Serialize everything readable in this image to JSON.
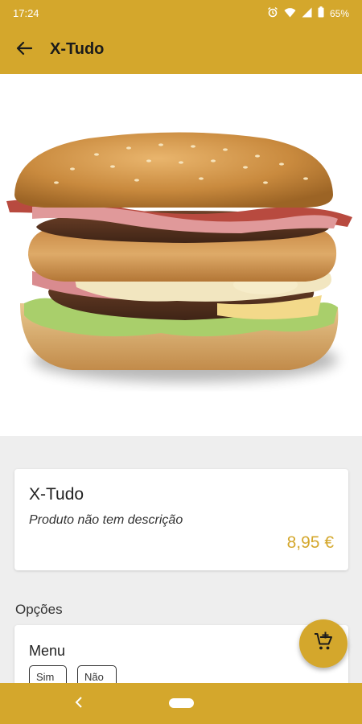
{
  "status_bar": {
    "time": "17:24",
    "battery": "65%"
  },
  "app_bar": {
    "title": "X-Tudo"
  },
  "product": {
    "name": "X-Tudo",
    "description": "Produto não tem descrição",
    "price": "8,95 €",
    "image": "burger-photo"
  },
  "options": {
    "section_title": "Opções",
    "group_label": "Menu",
    "choices": [
      "Sim",
      "Não"
    ]
  },
  "colors": {
    "primary": "#d4a72c",
    "background": "#eeeeee",
    "surface": "#ffffff"
  },
  "icons": [
    "back-arrow-icon",
    "alarm-icon",
    "wifi-icon",
    "signal-icon",
    "battery-icon",
    "add-to-cart-icon",
    "nav-back-icon"
  ]
}
